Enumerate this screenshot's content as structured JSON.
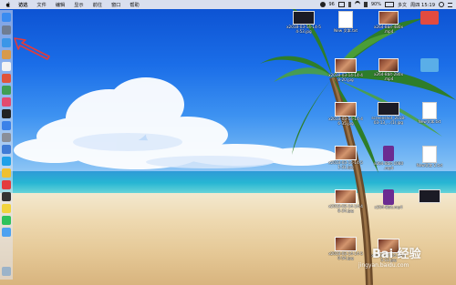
{
  "menubar": {
    "app_menus": [
      "访达",
      "文件",
      "编辑",
      "显示",
      "前往",
      "窗口",
      "帮助"
    ],
    "status": {
      "clock": "周四 15:19",
      "battery": "90%",
      "misc": "96",
      "lang_short": "多文",
      "percent_hint": "4"
    }
  },
  "dock": {
    "icons": [
      {
        "name": "finder-icon",
        "color": "#3a8bf0"
      },
      {
        "name": "launchpad-icon",
        "color": "#6f7d93"
      },
      {
        "name": "safari-icon",
        "color": "#3b96e8"
      },
      {
        "name": "contacts-icon",
        "color": "#d89a4b"
      },
      {
        "name": "calendar-icon",
        "color": "#f3f3f3"
      },
      {
        "name": "photos-icon",
        "color": "#e0543c"
      },
      {
        "name": "messages-icon",
        "color": "#3f9e55"
      },
      {
        "name": "itunes-icon",
        "color": "#e34a70"
      },
      {
        "name": "terminal-icon",
        "color": "#222222"
      },
      {
        "name": "appstore-icon",
        "color": "#3b82e8"
      },
      {
        "name": "systemprefs-icon",
        "color": "#8a8f99"
      },
      {
        "name": "xcode-icon",
        "color": "#3e7bd6"
      },
      {
        "name": "qq-icon",
        "color": "#1ea0e8"
      },
      {
        "name": "chrome-icon",
        "color": "#f0c030"
      },
      {
        "name": "weibo-icon",
        "color": "#e43d3d"
      },
      {
        "name": "terminal2-icon",
        "color": "#333333"
      },
      {
        "name": "notes-icon",
        "color": "#f2d33d"
      },
      {
        "name": "wechat-icon",
        "color": "#2fc25b"
      },
      {
        "name": "finder2-icon",
        "color": "#4ea2f0"
      },
      {
        "name": "trash-icon",
        "color": "#9bb3c9"
      }
    ]
  },
  "desktop_items": [
    {
      "id": "v1",
      "label": "x2018-03-14-14-5\n4-53.jpg",
      "kind": "dark"
    },
    {
      "id": "d1",
      "label": "New 文本.txt",
      "kind": "doc"
    },
    {
      "id": "v2",
      "label": "x264-8bit-480x\n.mp4",
      "kind": "video"
    },
    {
      "id": "f1",
      "label": "",
      "kind": "folder-red"
    },
    {
      "id": "p1",
      "label": "x2018-03-14-14-4\n8-20.jpg",
      "kind": "photo"
    },
    {
      "id": "v3",
      "label": "x264-8bit-280x\n.mp4",
      "kind": "video"
    },
    {
      "id": "f2",
      "label": "",
      "kind": "folder-blue"
    },
    {
      "id": "p2",
      "label": "x2018-03-14-14-4\n6-35.jpg",
      "kind": "photo"
    },
    {
      "id": "s1",
      "label": "screenshot_2018-\n03-13_…(1).jpg",
      "kind": "dark"
    },
    {
      "id": "d2",
      "label": "New文本.txt",
      "kind": "doc"
    },
    {
      "id": "p3",
      "label": "x2018-03-14-14-5\n1-31.jpg",
      "kind": "photo"
    },
    {
      "id": "m1",
      "label": "x264-8bit-1080\n.mp4",
      "kind": "purple"
    },
    {
      "id": "d3",
      "label": "New文本 2.txt",
      "kind": "doc"
    },
    {
      "id": "p4",
      "label": "x2018-03-14-14-4\n8-34.jpg",
      "kind": "photo"
    },
    {
      "id": "m2",
      "label": "x264-8bit.mp4",
      "kind": "purple"
    },
    {
      "id": "s2",
      "label": "",
      "kind": "dark"
    },
    {
      "id": "p5",
      "label": "x2018-03-14-14-5\n0-54.jpg",
      "kind": "photo"
    },
    {
      "id": "p6",
      "label": "x2018-03-14-14-4\n5-13.jpg",
      "kind": "photo"
    }
  ],
  "watermark": {
    "main": "Bai 经验",
    "sub": "",
    "url": "jingyan.baidu.com"
  }
}
